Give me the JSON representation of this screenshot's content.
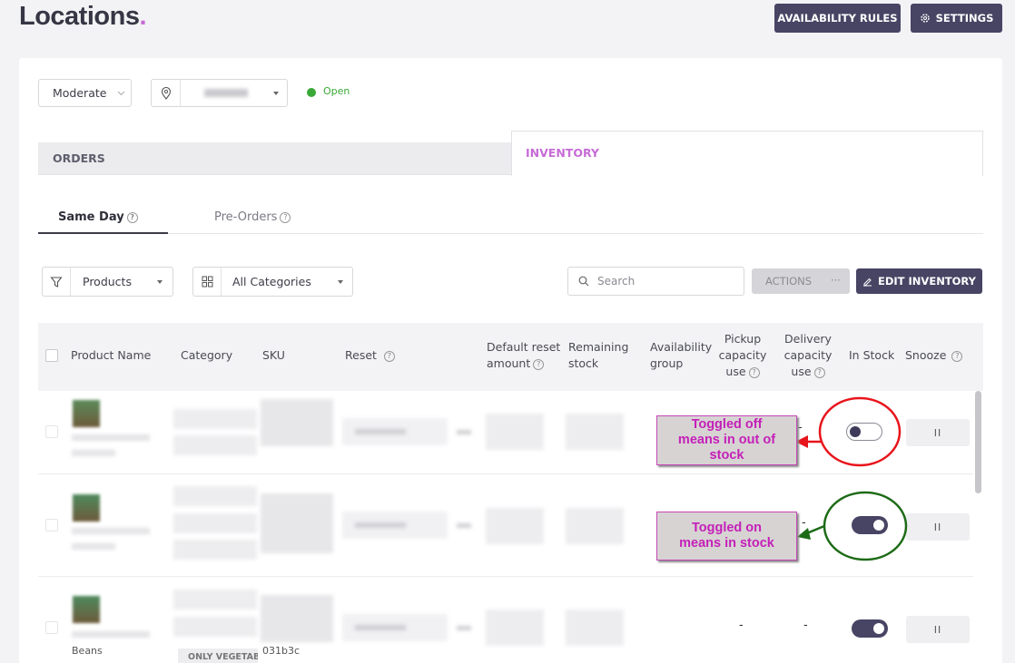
{
  "page": {
    "title": "Locations",
    "title_dot": "."
  },
  "header": {
    "availability_rules": "AVAILABILITY RULES",
    "settings": "SETTINGS"
  },
  "controls": {
    "mode": "Moderate",
    "status": "Open"
  },
  "tabs": {
    "orders": "ORDERS",
    "inventory": "INVENTORY"
  },
  "subtabs": {
    "same_day": "Same Day",
    "pre_orders": "Pre-Orders"
  },
  "filters": {
    "type": "Products",
    "category": "All Categories"
  },
  "search": {
    "placeholder": "Search"
  },
  "toolbar": {
    "actions": "ACTIONS",
    "more": "···",
    "edit_inventory": "EDIT INVENTORY"
  },
  "table": {
    "headers": {
      "product_name": "Product Name",
      "category": "Category",
      "sku": "SKU",
      "reset": "Reset",
      "default_reset_1": "Default reset",
      "default_reset_2": "amount",
      "remaining_1": "Remaining",
      "remaining_2": "stock",
      "availability_1": "Availability",
      "availability_2": "group",
      "pickup_1": "Pickup",
      "pickup_2": "capacity",
      "pickup_3": "use",
      "delivery_1": "Delivery",
      "delivery_2": "capacity",
      "delivery_3": "use",
      "in_stock": "In Stock",
      "snooze": "Snooze"
    },
    "rows": [
      {
        "pickup": "",
        "delivery": "-",
        "in_stock": false,
        "snooze": "II"
      },
      {
        "pickup": "",
        "delivery": "-",
        "in_stock": true,
        "snooze": "II"
      },
      {
        "name_visible": "Beans",
        "category_tag": "ONLY VEGETAB",
        "sku_visible": "031b3c",
        "pickup": "-",
        "delivery": "-",
        "in_stock": true,
        "snooze": "II"
      }
    ]
  },
  "annotations": {
    "off_1": "Toggled off",
    "off_2": "means in out of",
    "off_3": "stock",
    "on_1": "Toggled on",
    "on_2": "means in stock",
    "off_color": "#e8141b",
    "on_color": "#1d6b16"
  },
  "colors": {
    "accent": "#c66bd6",
    "dark": "#484464",
    "open_green": "#3aa836"
  },
  "icons": [
    "gear-icon",
    "location-pin-icon",
    "filter-icon",
    "grid-icon",
    "search-icon",
    "pencil-icon",
    "help-icon",
    "chevron-down-icon"
  ]
}
